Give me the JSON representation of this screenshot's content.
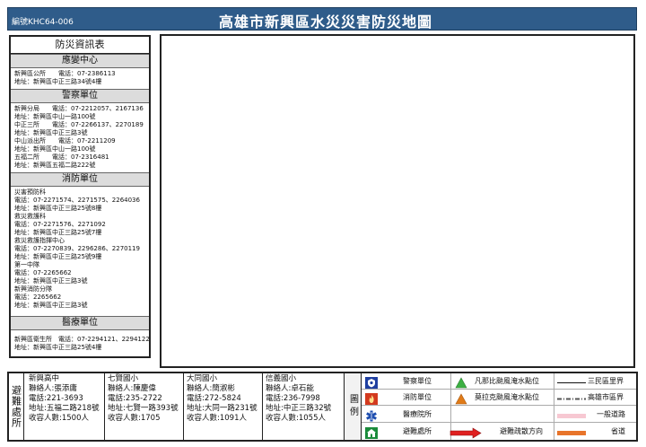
{
  "header": {
    "code": "編號KHC64-006",
    "title": "高雄市新興區水災災害防災地圖"
  },
  "info": {
    "title": "防災資訊表",
    "sections": [
      {
        "heading": "應變中心",
        "entries": [
          {
            "line": "新興區公所　　電話：07-2386113",
            "sub": "地址：新興區中正三路34號4樓"
          }
        ]
      },
      {
        "heading": "警察單位",
        "entries": [
          {
            "line": "新興分局　　電話：07-2212057、2167136",
            "sub": "地址：新興區中山一路100號"
          },
          {
            "line": "中正三所　　電話：07-2266137、2270189",
            "sub": "地址：新興區中正三路3號"
          },
          {
            "line": "中山派出所　　電話：07-2211209",
            "sub": "地址：新興區中山一路100號"
          },
          {
            "line": "五福二所　　電話：07-2316481",
            "sub": "地址：新興區五福二路222號"
          }
        ]
      },
      {
        "heading": "消防單位",
        "entries": [
          {
            "line": "災害預防科",
            "sub": ""
          },
          {
            "line": "電話：07-2271574、2271575、2264036",
            "sub": "地址：新興區中正三路25號8樓"
          },
          {
            "line": "救災救護科",
            "sub": ""
          },
          {
            "line": "電話：07-2271576、2271092",
            "sub": "地址：新興區中正三路25號7樓"
          },
          {
            "line": "救災救護指揮中心",
            "sub": ""
          },
          {
            "line": "電話：07-2270839、2296286、2270119",
            "sub": "地址：新興區中正三路25號9樓"
          },
          {
            "line": "第一中隊",
            "sub": ""
          },
          {
            "line": "電話：07-2265662",
            "sub": "地址：新興區中正三路3號"
          },
          {
            "line": "新興消防分隊",
            "sub": ""
          },
          {
            "line": "電話：2265662",
            "sub": "地址：新興區中正三路3號"
          }
        ]
      },
      {
        "heading": "醫療單位",
        "entries": [
          {
            "line": "新興區衛生所　電話：07-2294121、2294122",
            "sub": "地址：新興區中正三路25號4樓"
          }
        ]
      }
    ]
  },
  "shelters": {
    "label": "避難處所",
    "items": [
      {
        "name": "新興高中",
        "contact": "聯絡人:張添庸",
        "phone": "電話:221-3693",
        "address": "地址:五福二路218號",
        "capacity": "收容人數:1500人"
      },
      {
        "name": "七賢國小",
        "contact": "聯絡人:陳慶偉",
        "phone": "電話:235-2722",
        "address": "地址:七賢一路393號",
        "capacity": "收容人數:1705"
      },
      {
        "name": "大同國小",
        "contact": "聯絡人:簡淑彬",
        "phone": "電話:272-5824",
        "address": "地址:大同一路231號",
        "capacity": "收容人數:1091人"
      },
      {
        "name": "信義國小",
        "contact": "聯絡人:卓石能",
        "phone": "電話:236-7998",
        "address": "地址:中正三路32號",
        "capacity": "收容人數:1055人"
      }
    ]
  },
  "legend": {
    "label": "圖例",
    "items": [
      {
        "text": "警察單位",
        "icon": "police-badge-icon",
        "color": "#1f3fa0"
      },
      {
        "text": "消防單位",
        "icon": "fire-station-icon",
        "color": "#d33a1f"
      },
      {
        "text": "醫療院所",
        "icon": "medical-star-icon",
        "color": "#1f4fb0"
      },
      {
        "text": "避難處所",
        "icon": "shelter-house-icon",
        "color": "#1a8a3a"
      },
      {
        "text": "凡那比颱風淹水點位",
        "icon": "green-triangle-icon",
        "color": "#3cb043"
      },
      {
        "text": "莫拉克颱風淹水點位",
        "icon": "orange-triangle-icon",
        "color": "#e07b18"
      },
      {
        "text": "避難疏散方向",
        "icon": "red-arrow-icon",
        "color": "#e02020"
      },
      {
        "text": "三民區里界",
        "icon": "black-line-icon",
        "color": "#111111"
      },
      {
        "text": "高雄市區界",
        "icon": "dash-dot-line-icon",
        "color": "#555555"
      },
      {
        "text": "一般道路",
        "icon": "pink-band-icon",
        "color": "#f7c8d2"
      },
      {
        "text": "省道",
        "icon": "orange-band-icon",
        "color": "#e8742a"
      }
    ]
  }
}
